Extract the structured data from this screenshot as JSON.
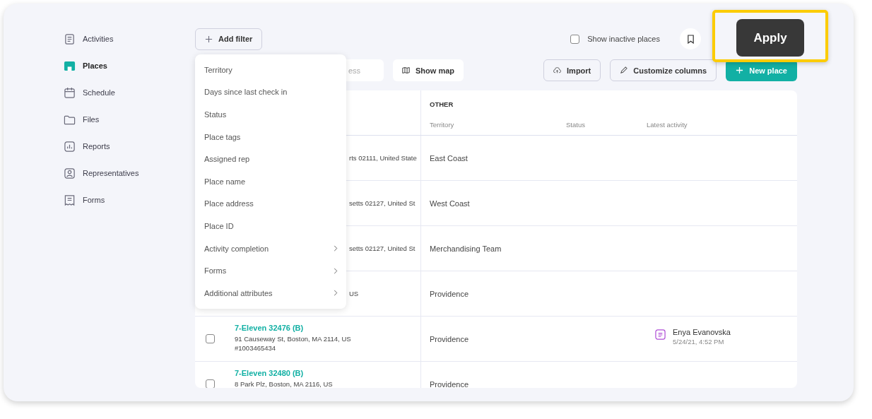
{
  "sidebar": {
    "items": [
      {
        "label": "Activities",
        "kind": "clipboard",
        "selected": false
      },
      {
        "label": "Places",
        "kind": "store",
        "selected": true
      },
      {
        "label": "Schedule",
        "kind": "calendar",
        "selected": false
      },
      {
        "label": "Files",
        "kind": "folder",
        "selected": false
      },
      {
        "label": "Reports",
        "kind": "chart",
        "selected": false
      },
      {
        "label": "Representatives",
        "kind": "person",
        "selected": false
      },
      {
        "label": "Forms",
        "kind": "form",
        "selected": false
      }
    ]
  },
  "toolbar": {
    "add_filter": "Add filter",
    "show_inactive": {
      "label": "Show inactive places",
      "checked": false
    },
    "apply": "Apply"
  },
  "actions": {
    "search": {
      "placeholder": "ess"
    },
    "show_map": "Show map",
    "import": "Import",
    "customize_columns": "Customize columns",
    "new_place": "New place"
  },
  "filter_menu": [
    {
      "label": "Territory",
      "has_submenu": false
    },
    {
      "label": "Days since last check in",
      "has_submenu": false
    },
    {
      "label": "Status",
      "has_submenu": false
    },
    {
      "label": "Place tags",
      "has_submenu": false
    },
    {
      "label": "Assigned rep",
      "has_submenu": false
    },
    {
      "label": "Place name",
      "has_submenu": false
    },
    {
      "label": "Place address",
      "has_submenu": false
    },
    {
      "label": "Place ID",
      "has_submenu": false
    },
    {
      "label": "Activity completion",
      "has_submenu": true
    },
    {
      "label": "Forms",
      "has_submenu": true
    },
    {
      "label": "Additional attributes",
      "has_submenu": true
    }
  ],
  "table": {
    "group_header": "OTHER",
    "columns": [
      "Territory",
      "Status",
      "Latest activity"
    ],
    "rows": [
      {
        "address": "rts 02111, United State",
        "territory": "East Coast"
      },
      {
        "address": "setts 02127, United St",
        "territory": "West Coast"
      },
      {
        "address": "setts 02127, United St",
        "territory": "Merchandising Team"
      },
      {
        "address": "US",
        "territory": "Providence"
      },
      {
        "checked": false,
        "name": "7-Eleven 32476 (B)",
        "address": "91 Causeway St, Boston, MA 2114, US",
        "place_id": "#1003465434",
        "territory": "Providence",
        "latest_activity": {
          "name": "Enya Evanovska",
          "time": "5/24/21, 4:52 PM"
        }
      },
      {
        "checked": false,
        "name": "7-Eleven 32480 (B)",
        "address": "8 Park Plz, Boston, MA 2116, US",
        "territory": "Providence"
      }
    ]
  }
}
